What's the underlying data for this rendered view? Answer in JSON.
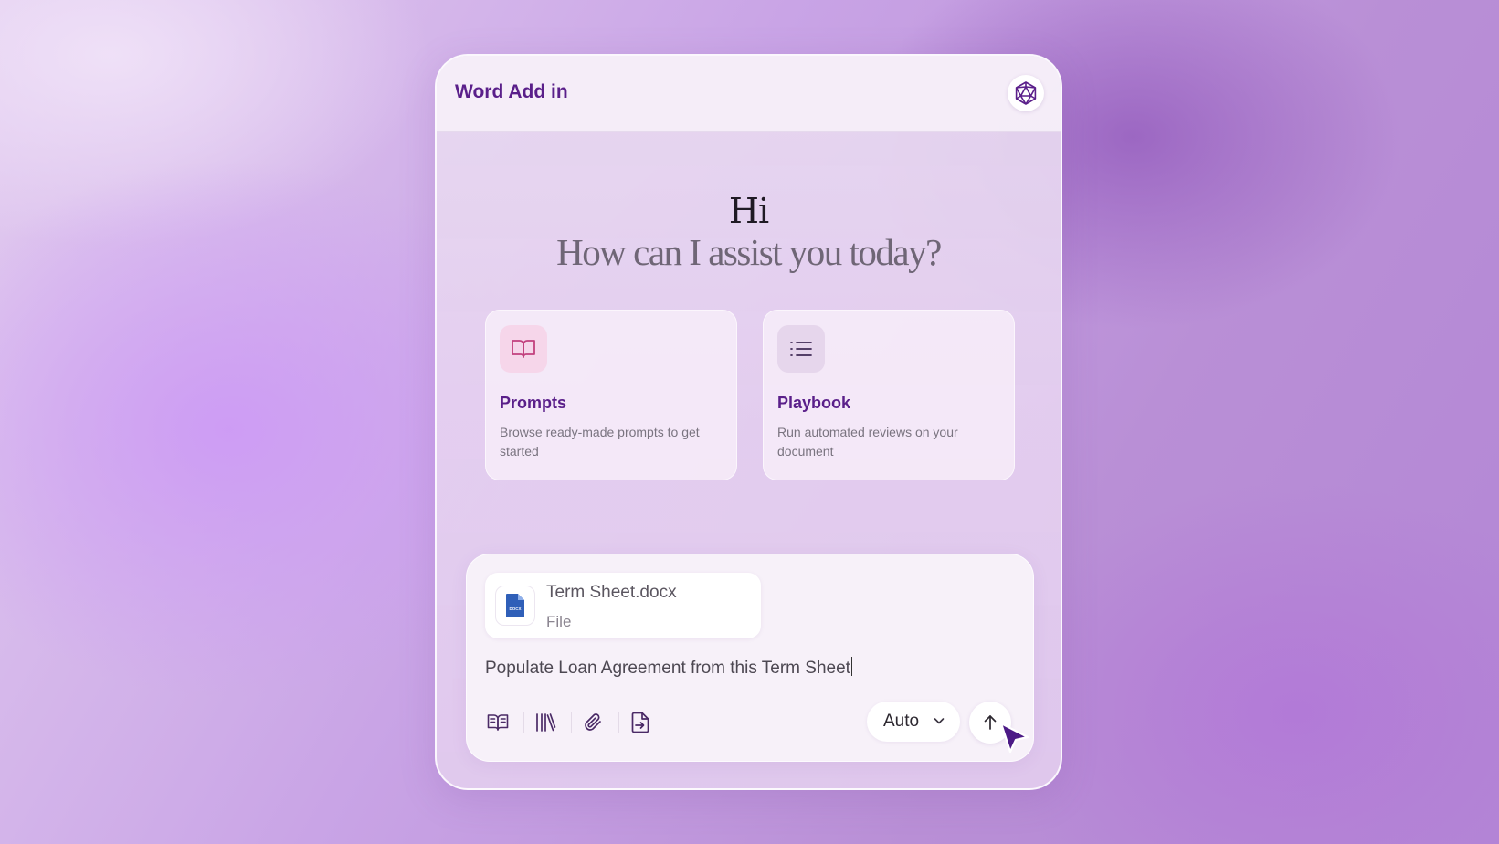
{
  "header": {
    "title": "Word Add in",
    "logo_icon": "geometric-logo-icon"
  },
  "greeting": {
    "hi": "Hi",
    "subtitle": "How can I assist you today?"
  },
  "cards": [
    {
      "icon": "open-book-icon",
      "title": "Prompts",
      "description": "Browse ready-made prompts to get started"
    },
    {
      "icon": "list-icon",
      "title": "Playbook",
      "description": "Run automated reviews on your document"
    }
  ],
  "composer": {
    "attachment": {
      "name": "Term Sheet.docx",
      "type": "File",
      "icon": "docx-file-icon",
      "icon_label": "DOCX"
    },
    "input_value": "Populate Loan Agreement from this Term Sheet",
    "tools": [
      "book-icon",
      "library-icon",
      "paperclip-icon",
      "file-import-icon"
    ],
    "model": {
      "selected": "Auto"
    },
    "send_icon": "arrow-up-icon"
  },
  "colors": {
    "accent": "#5a1f8a",
    "prompts_icon_bg": "#f6d6ea",
    "playbook_icon_bg": "#e6d6ec"
  }
}
